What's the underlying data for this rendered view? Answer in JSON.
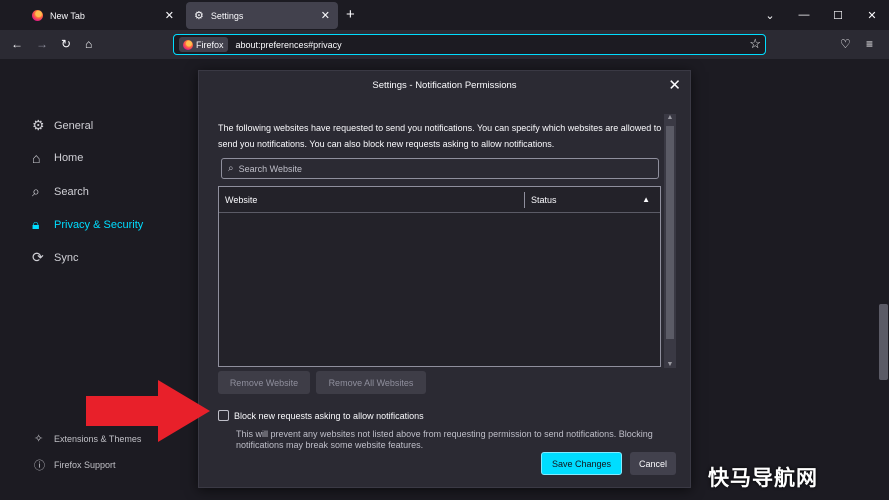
{
  "tabs": [
    {
      "label": "New Tab",
      "active": false
    },
    {
      "label": "Settings",
      "active": true
    }
  ],
  "navbar": {
    "identity_label": "Firefox",
    "url": "about:preferences#privacy"
  },
  "sidebar": {
    "items": [
      {
        "label": "General",
        "icon": "gear-icon"
      },
      {
        "label": "Home",
        "icon": "home-icon"
      },
      {
        "label": "Search",
        "icon": "search-icon"
      },
      {
        "label": "Privacy & Security",
        "icon": "lock-icon",
        "active": true
      },
      {
        "label": "Sync",
        "icon": "sync-icon"
      }
    ],
    "footer": [
      {
        "label": "Extensions & Themes",
        "icon": "puzzle-icon"
      },
      {
        "label": "Firefox Support",
        "icon": "help-icon"
      }
    ]
  },
  "dialog": {
    "title": "Settings - Notification Permissions",
    "description": "The following websites have requested to send you notifications. You can specify which websites are allowed to send you notifications. You can also block new requests asking to allow notifications.",
    "search_placeholder": "Search Website",
    "table": {
      "col_website": "Website",
      "col_status": "Status",
      "rows": []
    },
    "remove_label": "Remove Website",
    "remove_all_label": "Remove All Websites",
    "block_label": "Block new requests asking to allow notifications",
    "block_checked": false,
    "block_help": "This will prevent any websites not listed above from requesting permission to send notifications. Blocking notifications may break some website features.",
    "save_label": "Save Changes",
    "cancel_label": "Cancel"
  },
  "colors": {
    "accent": "#00ddff",
    "annotation_arrow": "#e8202a"
  },
  "watermark": "快马导航网"
}
